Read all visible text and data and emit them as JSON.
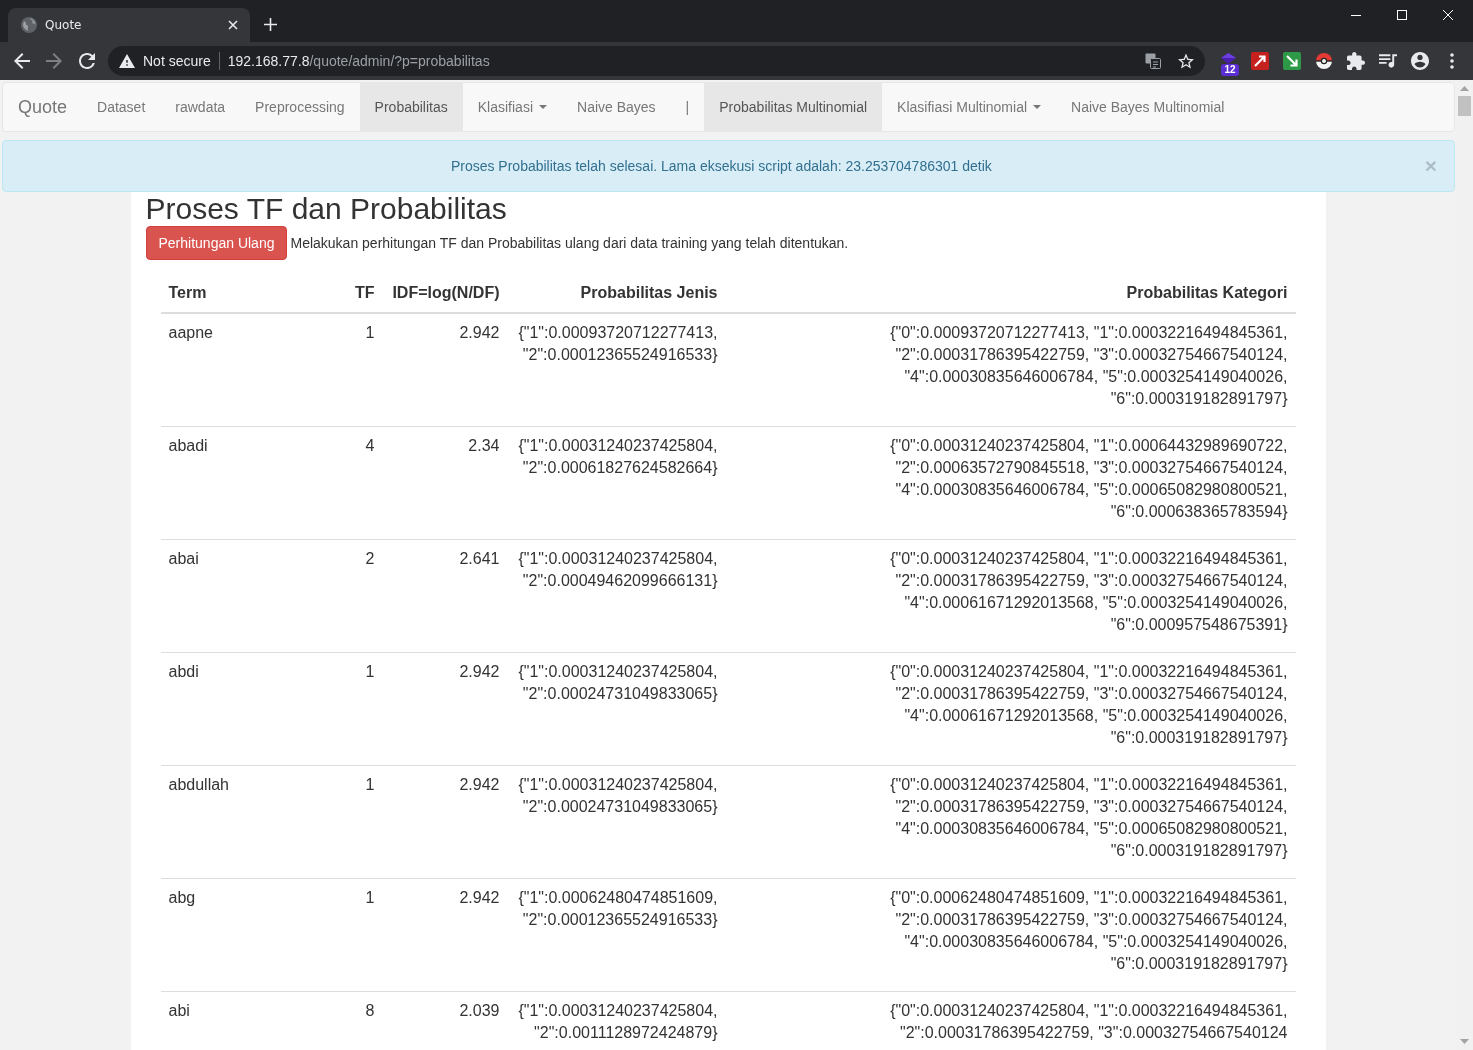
{
  "browser": {
    "tab_title": "Quote",
    "security_label": "Not secure",
    "url": {
      "host": "192.168.77.8",
      "path": "/quote/admin/?p=probabilitas"
    },
    "extension_badge": "12"
  },
  "navbar": {
    "brand": "Quote",
    "items": [
      {
        "label": "Dataset",
        "kind": "link",
        "selected": false
      },
      {
        "label": "rawdata",
        "kind": "link",
        "selected": false
      },
      {
        "label": "Preprocessing",
        "kind": "link",
        "selected": false
      },
      {
        "label": "Probabilitas",
        "kind": "link",
        "selected": true
      },
      {
        "label": "Klasifiasi",
        "kind": "dropdown",
        "selected": false
      },
      {
        "label": "Naive Bayes",
        "kind": "link",
        "selected": false
      },
      {
        "label": "|",
        "kind": "text",
        "selected": false
      },
      {
        "label": "Probabilitas Multinomial",
        "kind": "link",
        "selected": true
      },
      {
        "label": "Klasifiasi Multinomial",
        "kind": "dropdown",
        "selected": false
      },
      {
        "label": "Naive Bayes Multinomial",
        "kind": "link",
        "selected": false
      }
    ]
  },
  "alert": {
    "message": "Proses Probabilitas telah selesai. Lama eksekusi script adalah: 23.253704786301 detik",
    "close": "×"
  },
  "page": {
    "heading": "Proses TF dan Probabilitas",
    "button": "Perhitungan Ulang",
    "description": "Melakukan perhitungan TF dan Probabilitas ulang dari data training yang telah ditentukan."
  },
  "table": {
    "columns": [
      "Term",
      "TF",
      "IDF=log(N/DF)",
      "Probabilitas Jenis",
      "Probabilitas Kategori"
    ],
    "rows": [
      {
        "cells": [
          "aapne",
          "1",
          "2.942",
          "{\"1\":0.00093720712277413, \"2\":0.00012365524916533}",
          "{\"0\":0.00093720712277413, \"1\":0.00032216494845361, \"2\":0.00031786395422759, \"3\":0.00032754667540124, \"4\":0.00030835646006784, \"5\":0.0003254149040026, \"6\":0.000319182891797}"
        ]
      },
      {
        "cells": [
          "abadi",
          "4",
          "2.34",
          "{\"1\":0.00031240237425804, \"2\":0.00061827624582664}",
          "{\"0\":0.00031240237425804, \"1\":0.00064432989690722, \"2\":0.00063572790845518, \"3\":0.00032754667540124, \"4\":0.00030835646006784, \"5\":0.00065082980800521, \"6\":0.000638365783594}"
        ]
      },
      {
        "cells": [
          "abai",
          "2",
          "2.641",
          "{\"1\":0.00031240237425804, \"2\":0.00049462099666131}",
          "{\"0\":0.00031240237425804, \"1\":0.00032216494845361, \"2\":0.00031786395422759, \"3\":0.00032754667540124, \"4\":0.00061671292013568, \"5\":0.0003254149040026, \"6\":0.000957548675391}"
        ]
      },
      {
        "cells": [
          "abdi",
          "1",
          "2.942",
          "{\"1\":0.00031240237425804, \"2\":0.00024731049833065}",
          "{\"0\":0.00031240237425804, \"1\":0.00032216494845361, \"2\":0.00031786395422759, \"3\":0.00032754667540124, \"4\":0.00061671292013568, \"5\":0.0003254149040026, \"6\":0.000319182891797}"
        ]
      },
      {
        "cells": [
          "abdullah",
          "1",
          "2.942",
          "{\"1\":0.00031240237425804, \"2\":0.00024731049833065}",
          "{\"0\":0.00031240237425804, \"1\":0.00032216494845361, \"2\":0.00031786395422759, \"3\":0.00032754667540124, \"4\":0.00030835646006784, \"5\":0.00065082980800521, \"6\":0.000319182891797}"
        ]
      },
      {
        "cells": [
          "abg",
          "1",
          "2.942",
          "{\"1\":0.00062480474851609, \"2\":0.00012365524916533}",
          "{\"0\":0.00062480474851609, \"1\":0.00032216494845361, \"2\":0.00031786395422759, \"3\":0.00032754667540124, \"4\":0.00030835646006784, \"5\":0.0003254149040026, \"6\":0.000319182891797}"
        ]
      },
      {
        "cells": [
          "abi",
          "8",
          "2.039",
          "{\"1\":0.00031240237425804, \"2\":0.0011128972424879}",
          "{\"0\":0.00031240237425804, \"1\":0.00032216494845361, \"2\":0.00031786395422759, \"3\":0.00032754667540124"
        ]
      }
    ]
  }
}
